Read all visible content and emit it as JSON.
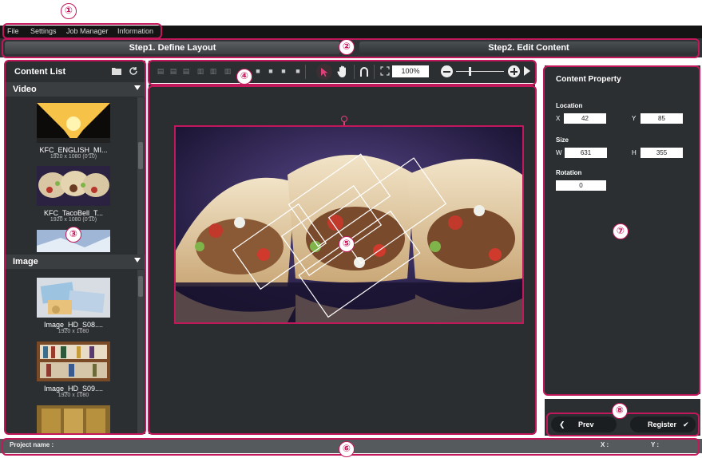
{
  "menu": [
    "File",
    "Settings",
    "Job Manager",
    "Information"
  ],
  "steps": {
    "step1": "Step1. Define Layout",
    "step2": "Step2. Edit Content"
  },
  "content_list": {
    "title": "Content List",
    "video_section": "Video",
    "image_section": "Image",
    "videos": [
      {
        "name": "KFC_ENGLISH_MI...",
        "dim": "1920 x 1080 (0'10)"
      },
      {
        "name": "KFC_TacoBell_T...",
        "dim": "1920 x 1080 (0'10)"
      }
    ],
    "images": [
      {
        "name": "Image_HD_S08....",
        "dim": "1920 x 1080"
      },
      {
        "name": "Image_HD_S09....",
        "dim": "1920 x 1080"
      }
    ]
  },
  "toolbar": {
    "zoom": "100%"
  },
  "property": {
    "title": "Content Property",
    "location_label": "Location",
    "x_label": "X",
    "x_value": "42",
    "y_label": "Y",
    "y_value": "85",
    "size_label": "Size",
    "w_label": "W",
    "w_value": "631",
    "h_label": "H",
    "h_value": "355",
    "rotation_label": "Rotation",
    "rotation_value": "0"
  },
  "buttons": {
    "prev": "Prev",
    "register": "Register"
  },
  "status": {
    "project_label": "Project name :",
    "x_label": "X :",
    "y_label": "Y :"
  },
  "callouts": [
    "①",
    "②",
    "③",
    "④",
    "⑤",
    "⑥",
    "⑦",
    "⑧"
  ],
  "colors": {
    "accent": "#c2185b",
    "panel": "#2b2f32",
    "step_active": "#5b5f62"
  }
}
